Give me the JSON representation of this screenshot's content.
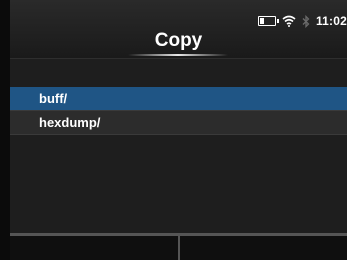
{
  "header": {
    "title": "Copy",
    "time": "11:02",
    "icons": [
      "battery-icon",
      "wifi-icon",
      "bluetooth-icon"
    ]
  },
  "list": {
    "items": [
      {
        "label": "buff/",
        "selected": true
      },
      {
        "label": "hexdump/",
        "selected": false
      }
    ]
  },
  "softkeys": {
    "left_label": "",
    "right_label": ""
  },
  "colors": {
    "selected_row": "#1f5585",
    "row_bg": "#2c2c2c",
    "screen_bg": "#1e1e1e"
  }
}
